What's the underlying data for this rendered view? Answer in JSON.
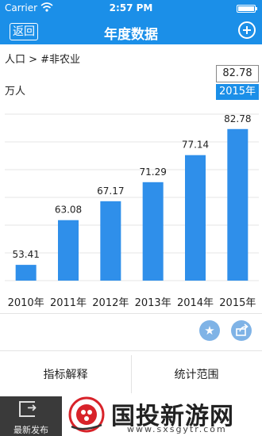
{
  "status_bar": {
    "carrier": "Carrier",
    "time": "2:57 PM"
  },
  "nav": {
    "back_label": "返回",
    "title": "年度数据"
  },
  "breadcrumb": "人口 > #非农业",
  "unit": "万人",
  "selection": {
    "value": "82.78",
    "year": "2015年"
  },
  "colors": {
    "accent": "#1b8fe8",
    "bar": "#2f8fea",
    "icon_button": "#7fb3e6"
  },
  "chart_data": {
    "type": "bar",
    "categories": [
      "2010年",
      "2011年",
      "2012年",
      "2013年",
      "2014年",
      "2015年"
    ],
    "values": [
      53.41,
      63.08,
      67.17,
      71.29,
      77.14,
      82.78
    ],
    "value_labels": [
      "53.41",
      "63.08",
      "67.17",
      "71.29",
      "77.14",
      "82.78"
    ],
    "ylabel": "万人",
    "ylim": [
      50,
      86
    ],
    "grid": true
  },
  "icons": {
    "favorite": "star-icon",
    "share": "share-icon",
    "latest": "exit-icon"
  },
  "tabs": {
    "explain": "指标解释",
    "scope": "统计范围"
  },
  "bottom": {
    "latest_label": "最新发布"
  },
  "watermark": {
    "title": "国投新游网",
    "url": "www.sxsgytr.com"
  }
}
